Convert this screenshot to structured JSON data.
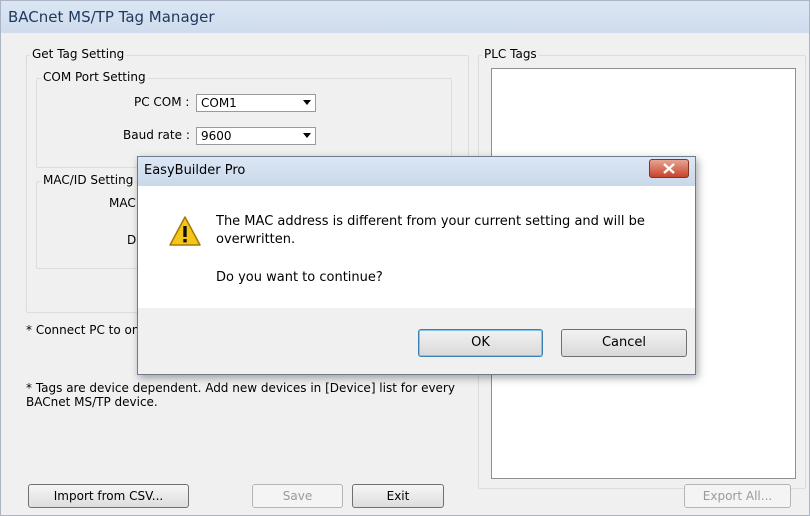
{
  "window": {
    "title": "BACnet MS/TP Tag Manager"
  },
  "get_tag_setting": {
    "group_label": "Get Tag Setting",
    "com_port": {
      "group_label": "COM Port Setting",
      "pc_com_label": "PC COM :",
      "pc_com_value": "COM1",
      "baud_rate_label": "Baud rate :",
      "baud_rate_value": "9600"
    },
    "mac_id": {
      "group_label": "MAC/ID Setting",
      "mac_label_partial": "MAC",
      "d_label_partial": "D"
    },
    "connect_note_partial": "* Connect PC to only",
    "tags_note": "* Tags are device dependent. Add new devices in [Device] list for every BACnet MS/TP device."
  },
  "plc_tags": {
    "group_label": "PLC Tags"
  },
  "buttons": {
    "import": "Import from CSV...",
    "save": "Save",
    "exit": "Exit",
    "export_all": "Export All..."
  },
  "dialog": {
    "title": "EasyBuilder Pro",
    "message": "The MAC address is different from your current setting and will be overwritten.",
    "question": "Do you want to continue?",
    "ok": "OK",
    "cancel": "Cancel"
  },
  "colors": {
    "titlebar": "#cfdced",
    "close_button": "#c7432b",
    "warning": "#f5c518"
  }
}
